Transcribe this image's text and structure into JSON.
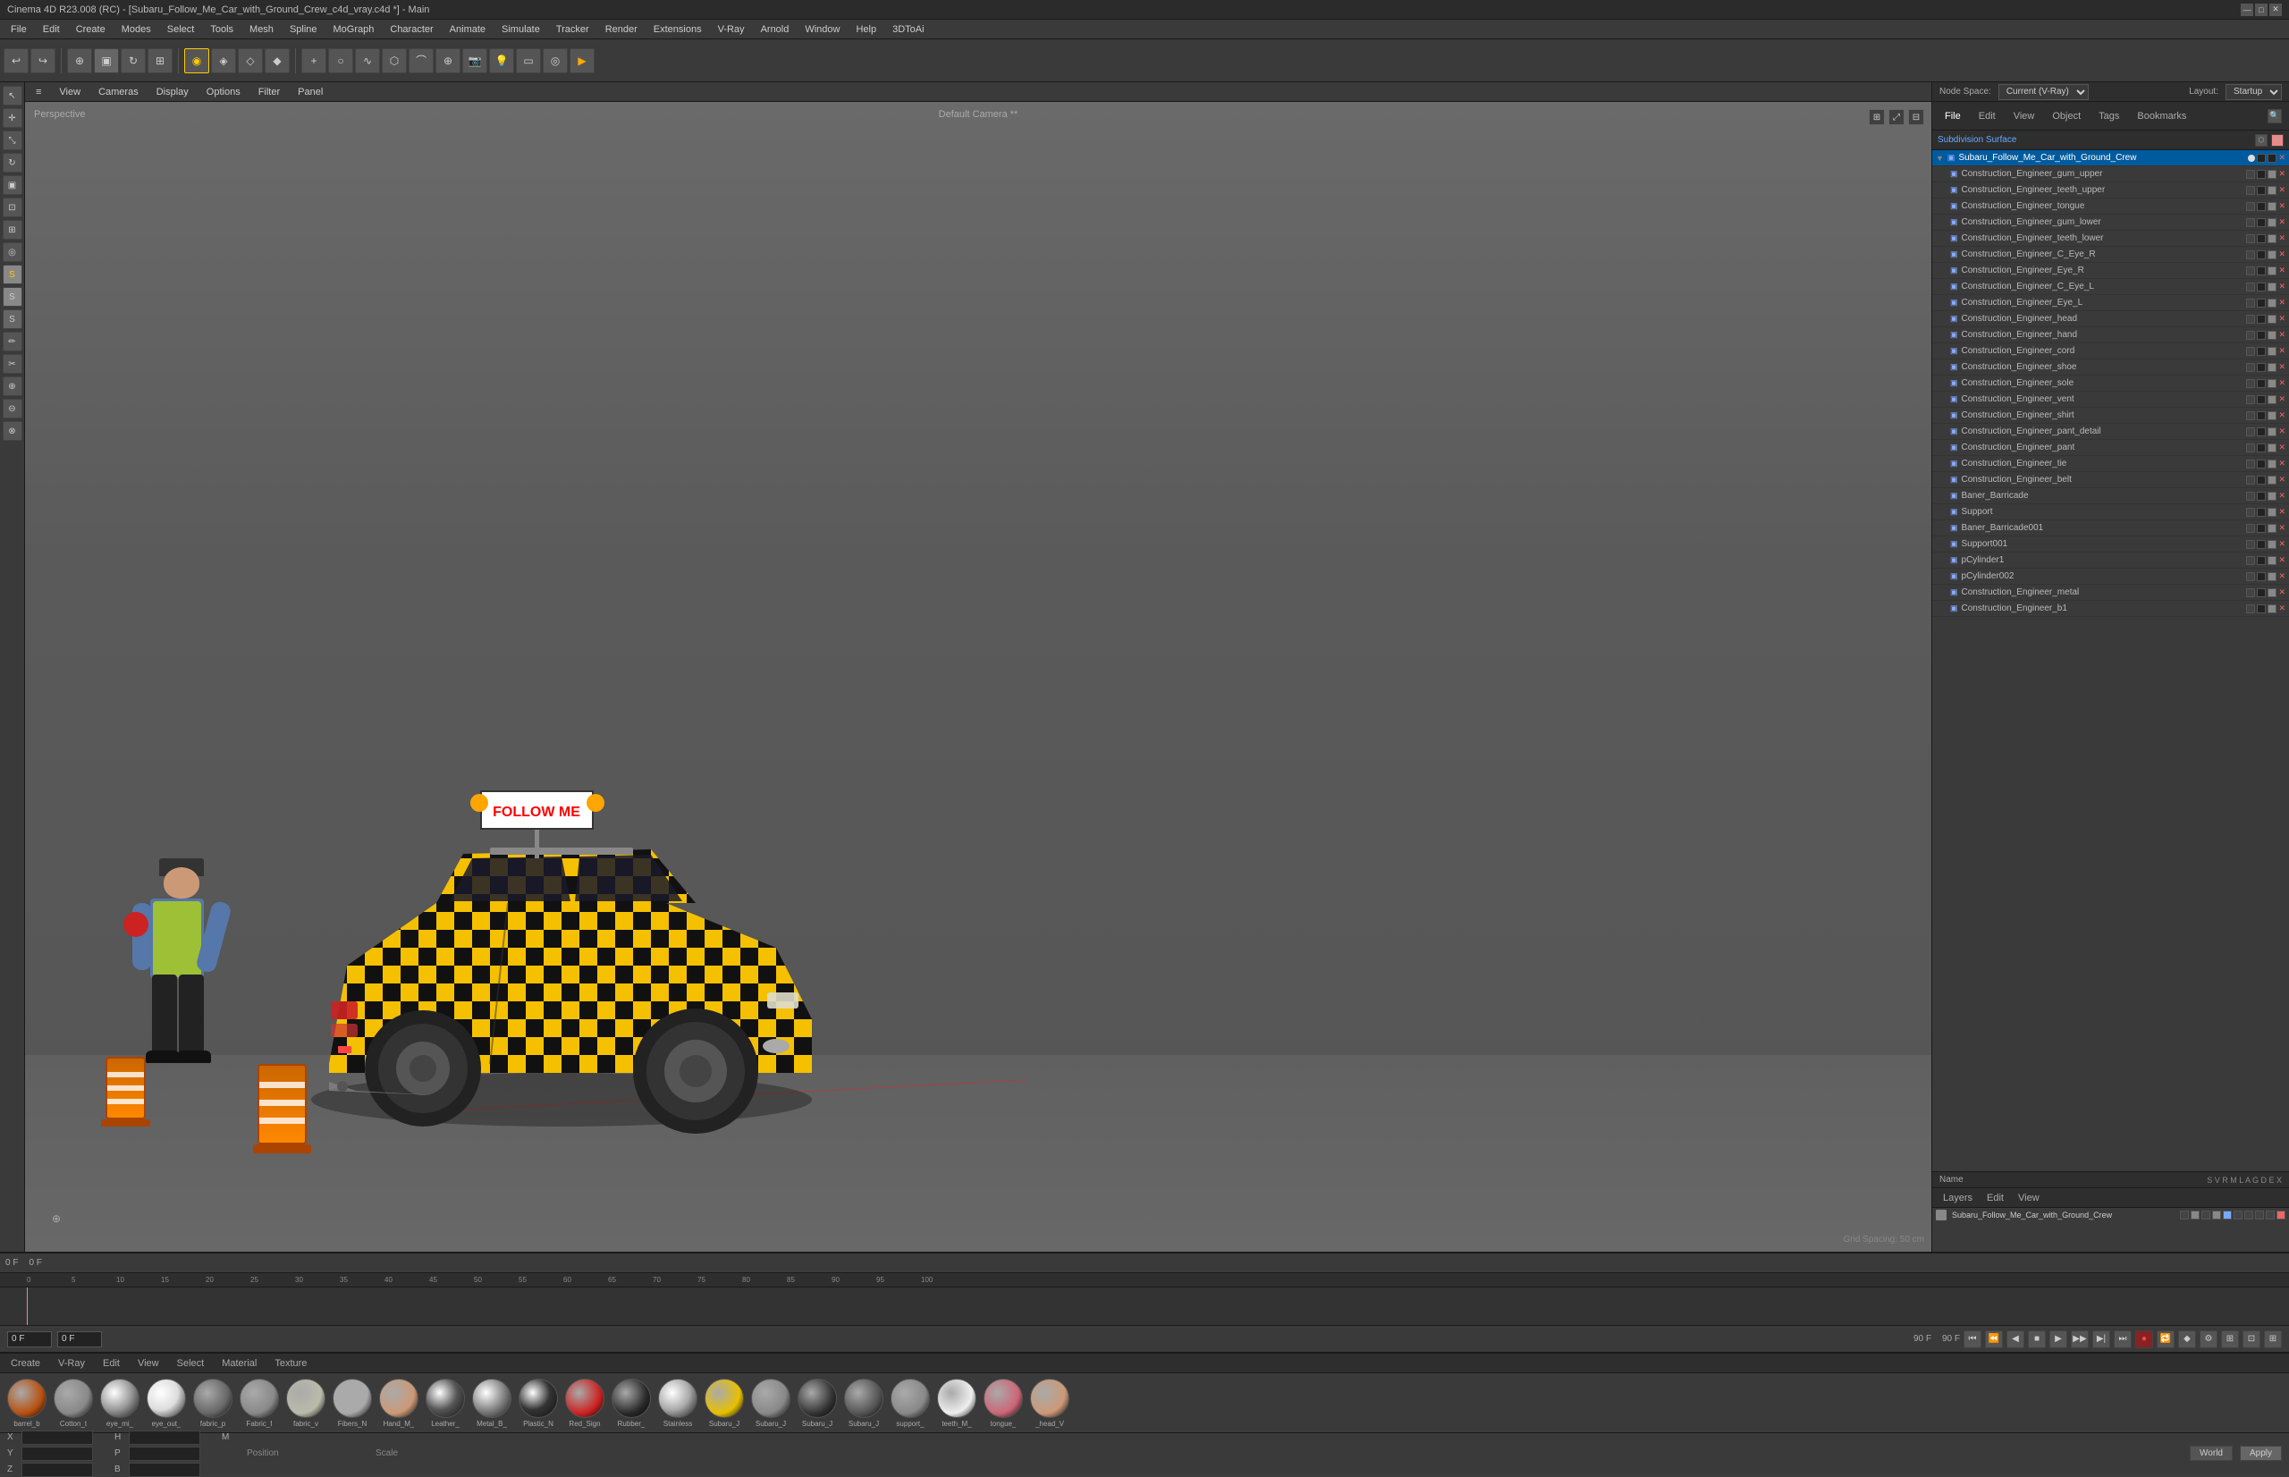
{
  "titlebar": {
    "title": "Cinema 4D R23.008 (RC) - [Subaru_Follow_Me_Car_with_Ground_Crew_c4d_vray.c4d *] - Main",
    "min": "—",
    "max": "□",
    "close": "✕"
  },
  "menubar": {
    "items": [
      "File",
      "Edit",
      "Create",
      "Modes",
      "Select",
      "Tools",
      "Mesh",
      "Spline",
      "MoGraph",
      "Character",
      "Animate",
      "Simulate",
      "Tracker",
      "Render",
      "Extensions",
      "V-Ray",
      "Arnold",
      "Window",
      "Help",
      "3DToAi"
    ]
  },
  "viewport": {
    "label": "Perspective",
    "camera": "Default Camera **",
    "grid_spacing": "Grid Spacing: 50 cm"
  },
  "right_panel": {
    "tabs": [
      "File",
      "Edit",
      "View",
      "Object",
      "Tags",
      "Bookmarks"
    ],
    "node_space_label": "Node Space:",
    "node_space_value": "Current (V-Ray)",
    "layout_label": "Layout:",
    "layout_value": "Startup",
    "root_item": "Subaru_Follow_Me_Car_with_Ground_Crew",
    "tree_items": [
      "Construction_Engineer_gum_upper",
      "Construction_Engineer_teeth_upper",
      "Construction_Engineer_tongue",
      "Construction_Engineer_gum_lower",
      "Construction_Engineer_teeth_lower",
      "Construction_Engineer_C_Eye_R",
      "Construction_Engineer_Eye_R",
      "Construction_Engineer_C_Eye_L",
      "Construction_Engineer_Eye_L",
      "Construction_Engineer_head",
      "Construction_Engineer_hand",
      "Construction_Engineer_cord",
      "Construction_Engineer_shoe",
      "Construction_Engineer_sole",
      "Construction_Engineer_vent",
      "Construction_Engineer_shirt",
      "Construction_Engineer_pant_detail",
      "Construction_Engineer_pant",
      "Construction_Engineer_tie",
      "Construction_Engineer_belt",
      "Baner_Barricade",
      "Support",
      "Baner_Barricade001",
      "Support001",
      "pCylinder1",
      "pCylinder002",
      "Construction_Engineer_metal",
      "Construction_Engineer_b1"
    ]
  },
  "layers_panel": {
    "tabs": [
      "Layers",
      "Edit",
      "View"
    ],
    "name_label": "Name",
    "icons": [
      "S",
      "V",
      "R",
      "M",
      "L",
      "A",
      "G",
      "D",
      "E",
      "X"
    ],
    "layer_name": "Subaru_Follow_Me_Car_with_Ground_Crew"
  },
  "coords_panel": {
    "position_label": "Position",
    "scale_label": "Scale",
    "rotation_label": "M",
    "x_label": "X",
    "y_label": "Y",
    "z_label": "Z",
    "x_pos": "",
    "y_pos": "",
    "z_pos": "",
    "x_scale": "",
    "y_scale": "",
    "z_scale": "",
    "p_label": "P",
    "h_label": "H",
    "b_label": "B",
    "apply_btn": "Apply",
    "world_btn": "World"
  },
  "timeline": {
    "frame_current": "0 F",
    "frame_end": "0 F",
    "frame_max": "90 F",
    "frame_max2": "90 F",
    "ruler_marks": [
      "0",
      "5",
      "10",
      "15",
      "20",
      "25",
      "30",
      "35",
      "40",
      "45",
      "50",
      "55",
      "60",
      "65",
      "70",
      "75",
      "80",
      "85",
      "90",
      "95",
      "100"
    ]
  },
  "materials": {
    "tabs": [
      "Create",
      "V-Ray",
      "Edit",
      "View",
      "Select",
      "Material",
      "Texture"
    ],
    "items": [
      {
        "label": "barrel_b",
        "color": "#b85010",
        "shine": false
      },
      {
        "label": "Cotton_t",
        "color": "#888",
        "shine": false
      },
      {
        "label": "eye_mi_",
        "color": "#999",
        "shine": true
      },
      {
        "label": "eye_out_",
        "color": "#ddd",
        "shine": true
      },
      {
        "label": "fabric_p",
        "color": "#666",
        "shine": false
      },
      {
        "label": "Fabric_f",
        "color": "#888",
        "shine": false
      },
      {
        "label": "fabric_v",
        "color": "#bba",
        "shine": false
      },
      {
        "label": "Fibers_N",
        "color": "#aaa",
        "shine": false
      },
      {
        "label": "Hand_M_",
        "color": "#cc9977",
        "shine": false
      },
      {
        "label": "Leather_",
        "color": "#555",
        "shine": true
      },
      {
        "label": "Metal_B_",
        "color": "#888",
        "shine": true
      },
      {
        "label": "Plastic_N",
        "color": "#333",
        "shine": true
      },
      {
        "label": "Red_Sign",
        "color": "#cc2222",
        "shine": false
      },
      {
        "label": "Rubber_",
        "color": "#2a2a2a",
        "shine": false
      },
      {
        "label": "Stainless",
        "color": "#aaa",
        "shine": true
      },
      {
        "label": "Subaru_J",
        "color": "#e8c000",
        "shine": false
      },
      {
        "label": "Subaru_J",
        "color": "#888",
        "shine": false
      },
      {
        "label": "Subaru_J",
        "color": "#333",
        "shine": false
      },
      {
        "label": "Subaru_J",
        "color": "#555",
        "shine": false
      },
      {
        "label": "support_",
        "color": "#888",
        "shine": false
      },
      {
        "label": "teeth_M_",
        "color": "#eee",
        "shine": false
      },
      {
        "label": "tongue_",
        "color": "#cc6677",
        "shine": false
      },
      {
        "label": "_head_V",
        "color": "#cc9977",
        "shine": false
      }
    ]
  }
}
